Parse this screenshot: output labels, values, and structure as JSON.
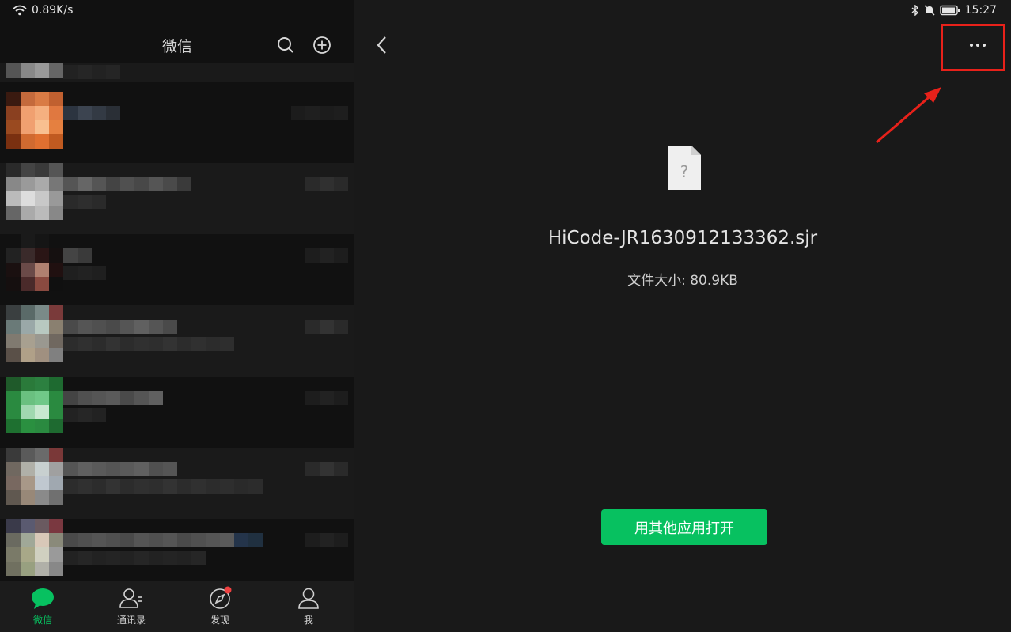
{
  "status_bar": {
    "network_speed": "0.89K/s",
    "time": "15:27",
    "icons": [
      "wifi-icon",
      "bluetooth-icon",
      "mute-bell-icon",
      "battery-icon"
    ]
  },
  "chat_pane": {
    "title": "微信",
    "header_icons": [
      "search-icon",
      "add-icon"
    ]
  },
  "tabs": [
    {
      "label": "微信",
      "icon": "chat-bubble-icon",
      "active": true
    },
    {
      "label": "通讯录",
      "icon": "contacts-icon",
      "active": false
    },
    {
      "label": "发现",
      "icon": "compass-icon",
      "active": false,
      "badge": "red-dot"
    },
    {
      "label": "我",
      "icon": "person-icon",
      "active": false
    }
  ],
  "file_view": {
    "back_icon": "chevron-left-icon",
    "more_icon": "more-dots-icon",
    "file_icon": "unknown-file-icon",
    "file_name": "HiCode-JR1630912133362.sjr",
    "file_size": "文件大小: 80.9KB",
    "open_button": "用其他应用打开"
  },
  "colors": {
    "accent": "#07c160",
    "annotation": "#e8211a",
    "background": "#191919"
  }
}
